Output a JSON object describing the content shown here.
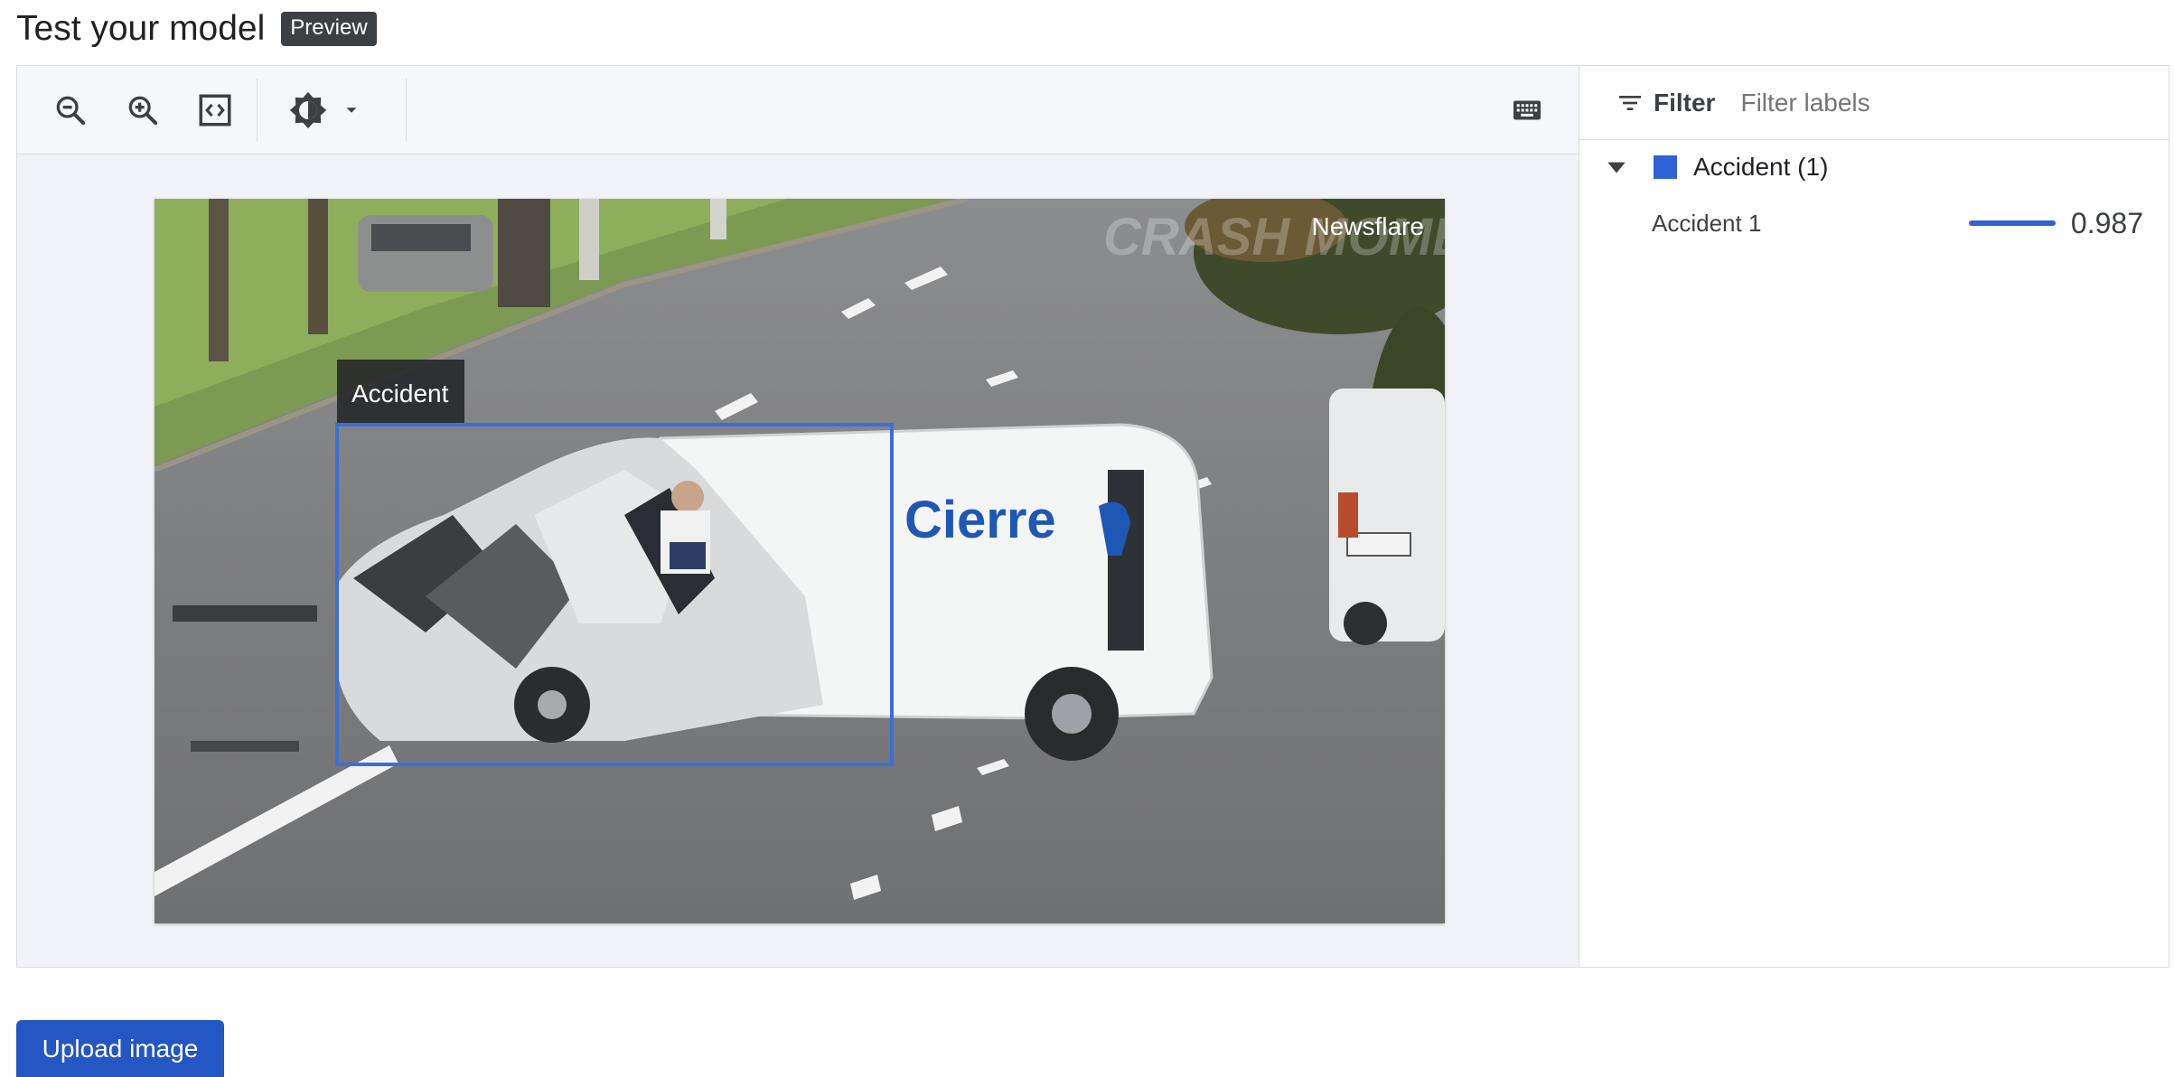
{
  "header": {
    "title": "Test your model",
    "badge": "Preview"
  },
  "toolbar": {
    "buttons": [
      "zoom-out-icon",
      "zoom-in-icon",
      "fit-to-screen-icon",
      "brightness-icon",
      "dropdown-arrow-icon"
    ],
    "keyboard_icon": "keyboard-icon"
  },
  "image": {
    "watermark": "Newsflare",
    "watermark_faint": "CRASH MOMENTS",
    "van_brand": "Cierre",
    "bbox_label": "Accident",
    "bbox_color": "#3a6fd8"
  },
  "filter": {
    "label": "Filter",
    "placeholder": "Filter labels"
  },
  "labels": {
    "group": {
      "name": "Accident (1)",
      "color": "#2f62d6"
    },
    "items": [
      {
        "name": "Accident 1",
        "score": "0.987",
        "score_fraction": 0.987
      }
    ]
  },
  "actions": {
    "upload": "Upload image"
  },
  "colors": {
    "accent": "#2456c4",
    "box": "#3a6fd8"
  }
}
